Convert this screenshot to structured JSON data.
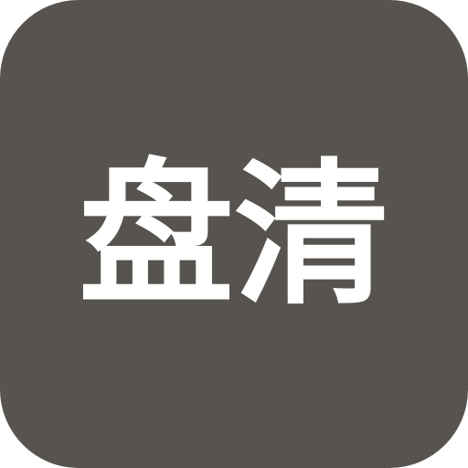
{
  "icon": {
    "label": "盘清",
    "background_color": "#57544f",
    "text_color": "#ffffff"
  }
}
